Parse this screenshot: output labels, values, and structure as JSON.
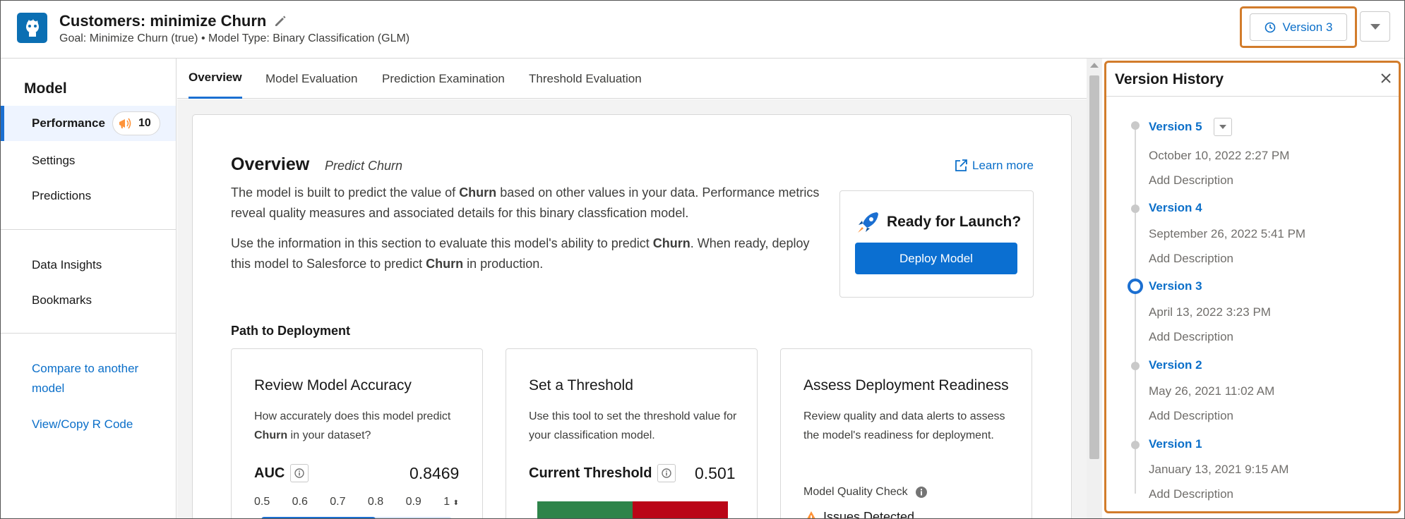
{
  "header": {
    "title": "Customers: minimize Churn",
    "subtitle": "Goal: Minimize Churn (true) • Model Type: Binary Classification (GLM)",
    "version_button": "Version 3"
  },
  "sidebar": {
    "heading": "Model",
    "items": [
      {
        "label": "Performance",
        "badge": "10"
      },
      {
        "label": "Settings"
      },
      {
        "label": "Predictions"
      },
      {
        "label": "Data Insights"
      },
      {
        "label": "Bookmarks"
      }
    ],
    "links": [
      "Compare to another model",
      "View/Copy R Code"
    ]
  },
  "tabs": [
    "Overview",
    "Model Evaluation",
    "Prediction Examination",
    "Threshold Evaluation"
  ],
  "overview": {
    "title": "Overview",
    "subtitle": "Predict Churn",
    "learn_more": "Learn more",
    "para1_a": "The model is built to predict the value of ",
    "para1_b": "Churn",
    "para1_c": " based on other values in your data. Performance metrics reveal quality measures and associated details for this binary classfication model.",
    "para2_a": "Use the information in this section to evaluate this model's ability to predict ",
    "para2_b": "Churn",
    "para2_c": ". When ready, deploy this model to Salesforce to predict ",
    "para2_d": "Churn",
    "para2_e": " in production.",
    "launch_title": "Ready for Launch?",
    "deploy_button": "Deploy Model",
    "path_title": "Path to Deployment"
  },
  "steps": {
    "accuracy": {
      "title": "Review Model Accuracy",
      "desc_a": "How accurately does this model predict ",
      "desc_b": "Churn",
      "desc_c": " in your dataset?",
      "metric": "AUC",
      "value": "0.8469",
      "ticks": [
        "0.5",
        "0.6",
        "0.7",
        "0.8",
        "0.9",
        "1"
      ],
      "fill_fraction": 0.6
    },
    "threshold": {
      "title": "Set a Threshold",
      "desc": "Use this tool to set the threshold value for your classification model.",
      "metric": "Current Threshold",
      "value": "0.501",
      "fill_fraction": 0.501
    },
    "readiness": {
      "title": "Assess Deployment Readiness",
      "desc": "Review quality and data alerts to assess the model's readiness for deployment.",
      "check_label": "Model Quality Check",
      "issues": "Issues Detected"
    }
  },
  "version_history": {
    "title": "Version History",
    "versions": [
      {
        "name": "Version 5",
        "date": "October 10, 2022 2:27 PM",
        "desc": "Add Description"
      },
      {
        "name": "Version 4",
        "date": "September 26, 2022 5:41 PM",
        "desc": "Add Description"
      },
      {
        "name": "Version 3",
        "date": "April 13, 2022 3:23 PM",
        "desc": "Add Description"
      },
      {
        "name": "Version 2",
        "date": "May 26, 2021 11:02 AM",
        "desc": "Add Description"
      },
      {
        "name": "Version 1",
        "date": "January 13, 2021 9:15 AM",
        "desc": "Add Description"
      }
    ]
  },
  "colors": {
    "brand": "#0b6fb3",
    "link": "#0b6fc9",
    "highlight_outline": "#d27c2b",
    "threshold_good": "#2e844a",
    "threshold_bad": "#ba0517"
  }
}
